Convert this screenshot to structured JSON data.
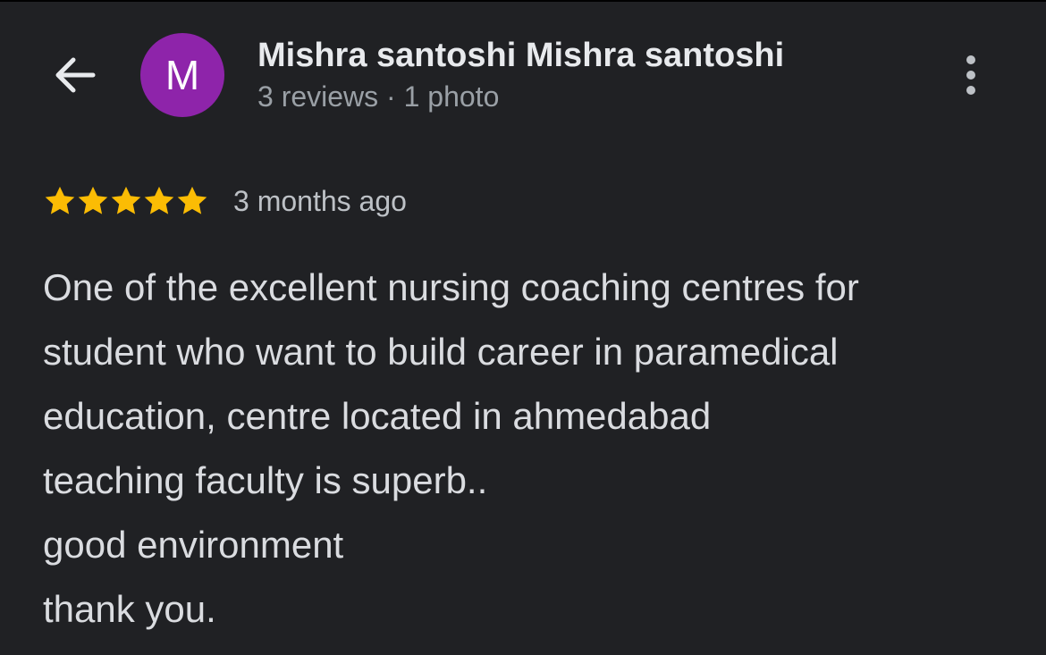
{
  "header": {
    "avatar_letter": "M",
    "avatar_color": "#8e24aa",
    "reviewer_name": "Mishra santoshi Mishra santoshi",
    "reviewer_meta": "3 reviews · 1 photo",
    "back_icon": "arrow-back-icon",
    "more_icon": "more-vertical-icon"
  },
  "review": {
    "rating": 5,
    "rating_max": 5,
    "star_color": "#fbbc04",
    "date": "3 months ago",
    "lines": [
      "One of the excellent nursing coaching centres for",
      "student who want to build career in paramedical",
      "education, centre located in ahmedabad",
      "teaching faculty is superb..",
      "good environment",
      "thank you."
    ]
  }
}
